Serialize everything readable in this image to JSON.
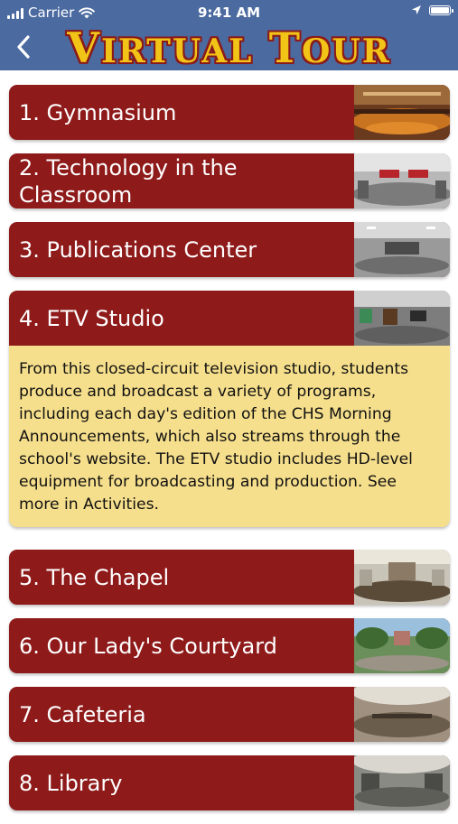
{
  "status": {
    "carrier": "Carrier",
    "time": "9:41 AM"
  },
  "nav": {
    "title_v": "V",
    "title_irtual": "IRTUAL",
    "title_t": "T",
    "title_our": "OUR"
  },
  "tour": [
    {
      "label": "1. Gymnasium",
      "thumb": "gym"
    },
    {
      "label": "2. Technology in the Classroom",
      "thumb": "classroom"
    },
    {
      "label": "3. Publications Center",
      "thumb": "office"
    },
    {
      "label": "4. ETV Studio",
      "thumb": "studio",
      "description": "From this closed-circuit television studio, students produce and broadcast a variety of programs, including each day's edition of the CHS Morning Announcements, which also streams through the school's website. The ETV studio includes HD-level equipment for broadcasting and production. See more in Activities."
    },
    {
      "label": "5. The Chapel",
      "thumb": "chapel"
    },
    {
      "label": "6. Our Lady's Courtyard",
      "thumb": "courtyard"
    },
    {
      "label": "7. Cafeteria",
      "thumb": "cafeteria"
    },
    {
      "label": "8. Library",
      "thumb": "library"
    }
  ],
  "colors": {
    "nav_bg": "#4b6aa0",
    "card_bg": "#8e1a1a",
    "desc_bg": "#f6df8c",
    "title": "#f2c417"
  },
  "icons": [
    "back-chevron-icon",
    "signal-bars-icon",
    "wifi-icon",
    "location-arrow-icon",
    "battery-icon"
  ]
}
